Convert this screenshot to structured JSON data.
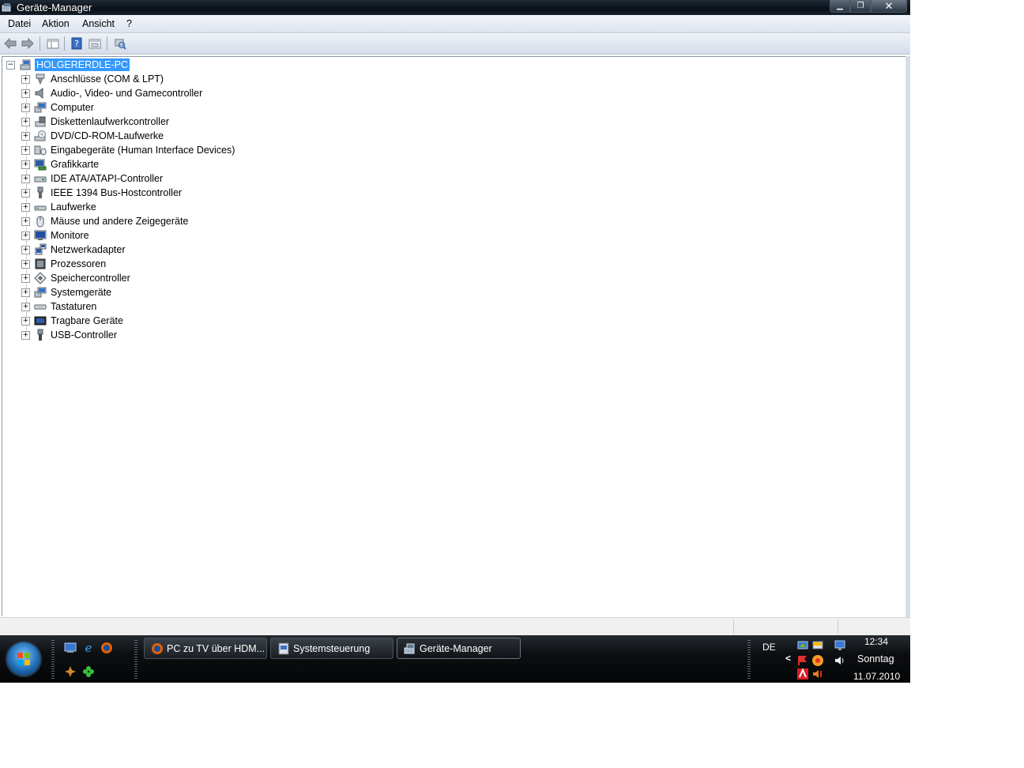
{
  "window": {
    "title": "Geräte-Manager",
    "buttons": {
      "minimize": "▁",
      "maximize": "❐",
      "close": "✕"
    }
  },
  "menu": [
    "Datei",
    "Aktion",
    "Ansicht",
    "?"
  ],
  "toolbar": {
    "icons": [
      "back-arrow-icon",
      "forward-arrow-icon",
      "show-hide-tree-icon",
      "help-icon",
      "properties-icon",
      "scan-hardware-icon"
    ]
  },
  "tree": {
    "root": "HOLGERERDLE-PC",
    "root_expander": "−",
    "expander": "+",
    "categories": [
      {
        "label": "Anschlüsse (COM & LPT)",
        "icon": "port-icon"
      },
      {
        "label": "Audio-, Video- und Gamecontroller",
        "icon": "speaker-icon"
      },
      {
        "label": "Computer",
        "icon": "computer-icon"
      },
      {
        "label": "Diskettenlaufwerkcontroller",
        "icon": "floppy-controller-icon"
      },
      {
        "label": "DVD/CD-ROM-Laufwerke",
        "icon": "dvd-drive-icon"
      },
      {
        "label": "Eingabegeräte (Human Interface Devices)",
        "icon": "hid-icon"
      },
      {
        "label": "Grafikkarte",
        "icon": "display-adapter-icon"
      },
      {
        "label": "IDE ATA/ATAPI-Controller",
        "icon": "ide-controller-icon"
      },
      {
        "label": "IEEE 1394 Bus-Hostcontroller",
        "icon": "firewire-icon"
      },
      {
        "label": "Laufwerke",
        "icon": "disk-drive-icon"
      },
      {
        "label": "Mäuse und andere Zeigegeräte",
        "icon": "mouse-icon"
      },
      {
        "label": "Monitore",
        "icon": "monitor-icon"
      },
      {
        "label": "Netzwerkadapter",
        "icon": "network-adapter-icon"
      },
      {
        "label": "Prozessoren",
        "icon": "processor-icon"
      },
      {
        "label": "Speichercontroller",
        "icon": "storage-controller-icon"
      },
      {
        "label": "Systemgeräte",
        "icon": "system-devices-icon"
      },
      {
        "label": "Tastaturen",
        "icon": "keyboard-icon"
      },
      {
        "label": "Tragbare Geräte",
        "icon": "portable-device-icon"
      },
      {
        "label": "USB-Controller",
        "icon": "usb-icon"
      }
    ]
  },
  "taskbar": {
    "quicklaunch": [
      "show-desktop-icon",
      "internet-explorer-icon",
      "firefox-icon",
      "app-icon",
      "clover-icon"
    ],
    "tasks": [
      {
        "label": "PC zu TV über HDM...",
        "icon": "firefox-icon",
        "active": false
      },
      {
        "label": "Systemsteuerung",
        "icon": "control-panel-icon",
        "active": false
      },
      {
        "label": "Geräte-Manager",
        "icon": "device-manager-icon",
        "active": true
      }
    ],
    "language": "DE",
    "tray_chevron": "<",
    "clock": {
      "time": "12:34",
      "day": "Sonntag",
      "date": "11.07.2010"
    }
  },
  "colors": {
    "selection": "#3399ff",
    "titlebar": "#0b1016",
    "taskbar": "#0c0e11"
  }
}
